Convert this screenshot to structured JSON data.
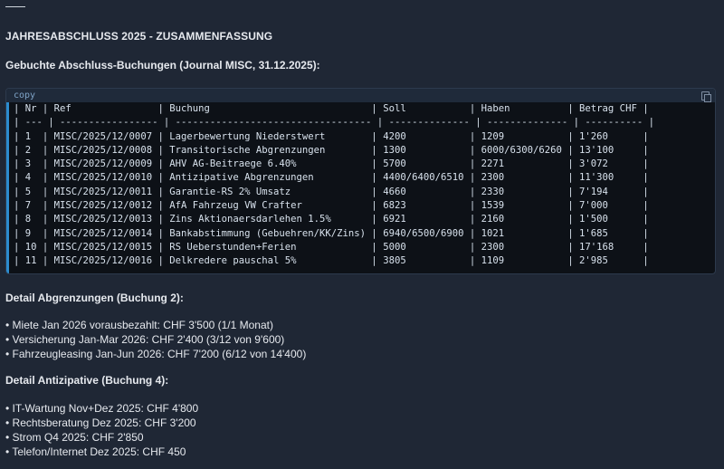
{
  "heading": "JAHRESABSCHLUSS 2025 - ZUSAMMENFASSUNG",
  "subheading": "Gebuchte Abschluss-Buchungen (Journal MISC, 31.12.2025):",
  "codeblock": {
    "label": "copy",
    "lines": [
      "| Nr | Ref               | Buchung                            | Soll           | Haben          | Betrag CHF |",
      "| --- | ----------------- | ---------------------------------- | -------------- | -------------- | ---------- |",
      "| 1  | MISC/2025/12/0007 | Lagerbewertung Niederstwert        | 4200           | 1209           | 1'260      |",
      "| 2  | MISC/2025/12/0008 | Transitorische Abgrenzungen        | 1300           | 6000/6300/6260 | 13'100     |",
      "| 3  | MISC/2025/12/0009 | AHV AG-Beitraege 6.40%             | 5700           | 2271           | 3'072      |",
      "| 4  | MISC/2025/12/0010 | Antizipative Abgrenzungen          | 4400/6400/6510 | 2300           | 11'300     |",
      "| 5  | MISC/2025/12/0011 | Garantie-RS 2% Umsatz              | 4660           | 2330           | 7'194      |",
      "| 7  | MISC/2025/12/0012 | AfA Fahrzeug VW Crafter            | 6823           | 1539           | 7'000      |",
      "| 8  | MISC/2025/12/0013 | Zins Aktionaersdarlehen 1.5%       | 6921           | 2160           | 1'500      |",
      "| 9  | MISC/2025/12/0014 | Bankabstimmung (Gebuehren/KK/Zins) | 6940/6500/6900 | 1021           | 1'685      |",
      "| 10 | MISC/2025/12/0015 | RS Ueberstunden+Ferien             | 5000           | 2300           | 17'168     |",
      "| 11 | MISC/2025/12/0016 | Delkredere pauschal 5%             | 3805           | 1109           | 2'985      |"
    ]
  },
  "detail_abgrenzungen": {
    "title": "Detail Abgrenzungen (Buchung 2):",
    "items": [
      "• Miete Jan 2026 vorausbezahlt: CHF 3'500 (1/1 Monat)",
      "• Versicherung Jan-Mar 2026: CHF 2'400 (3/12 von 9'600)",
      "• Fahrzeugleasing Jan-Jun 2026: CHF 7'200 (6/12 von 14'400)"
    ]
  },
  "detail_antizipative": {
    "title": "Detail Antizipative (Buchung 4):",
    "items": [
      "• IT-Wartung Nov+Dez 2025: CHF 4'800",
      "• Rechtsberatung Dez 2025: CHF 3'200",
      "• Strom Q4 2025: CHF 2'850",
      "• Telefon/Internet Dez 2025: CHF 450"
    ]
  },
  "icons": {
    "copy": "copy-icon"
  }
}
